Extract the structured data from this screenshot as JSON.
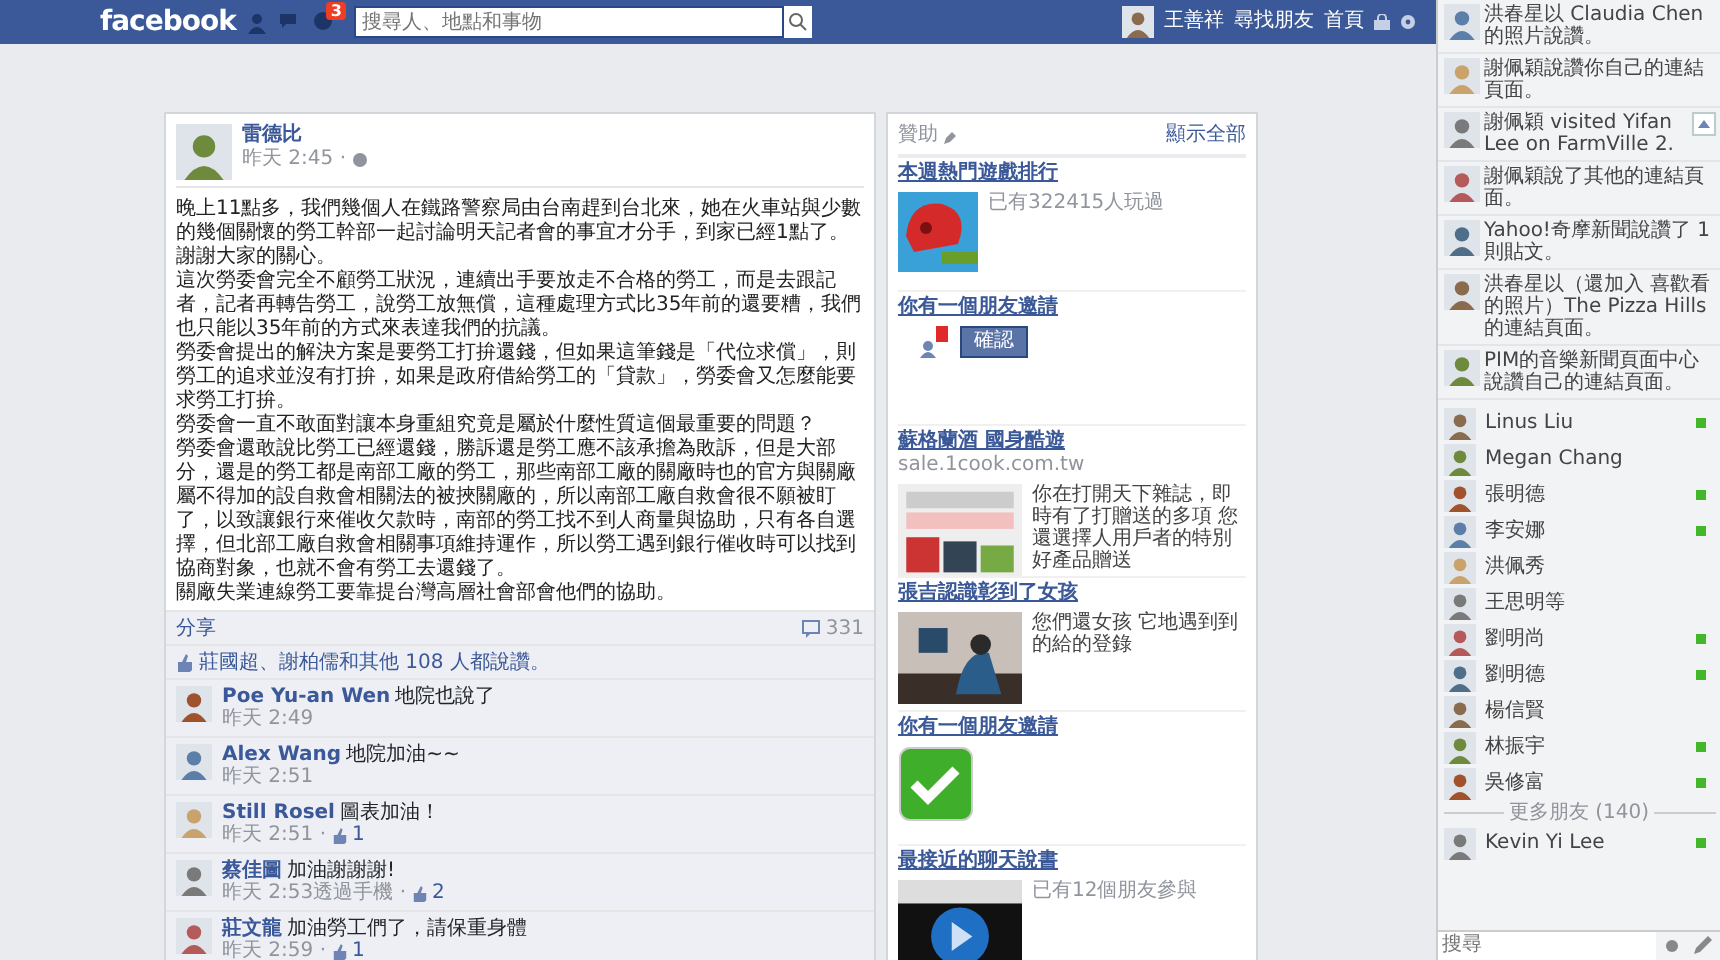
{
  "topbar": {
    "logo": "facebook",
    "notification_count": "3",
    "search": {
      "placeholder": "搜尋人、地點和事物"
    },
    "user_name": "王善祥",
    "links": [
      "尋找朋友",
      "首頁"
    ]
  },
  "post": {
    "author": "雷德比",
    "time": "昨天 2:45 · ",
    "paragraphs": [
      "晚上11點多，我們幾個人在鐵路警察局由台南趕到台北來，她在火車站與少數的幾個關懷的勞工幹部一起討論明天記者會的事宜才分手，到家已經1點了。謝謝大家的關心。",
      "這次勞委會完全不顧勞工狀況，連續出手要放走不合格的勞工，而是去跟記者，記者再轉告勞工，說勞工放無償，這種處理方式比35年前的還要糟，我們也只能以35年前的方式來表達我們的抗議。",
      "勞委會提出的解決方案是要勞工打拚還錢，但如果這筆錢是「代位求償」，則勞工的追求並沒有打拚，如果是政府借給勞工的「貸款」，勞委會又怎麼能要求勞工打拚。",
      "勞委會一直不敢面對讓本身重組究竟是屬於什麼性質這個最重要的問題？",
      "勞委會還敢說比勞工已經還錢，勝訴還是勞工應不該承擔為敗訴，但是大部分，還是的勞工都是南部工廠的勞工，那些南部工廠的關廠時也的官方與關廠屬不得加的設自救會相關法的被挾關廠的，所以南部工廠自救會很不願被盯了，以致讓銀行來催收欠款時，南部的勞工找不到人商量與協助，只有各自選擇，但北部工廠自救會相關事項維持運作，所以勞工遇到銀行催收時可以找到協商對象，也就不會有勞工去還錢了。",
      "關廠失業連線勞工要靠提台灣高層社會部會他們的協助。"
    ],
    "share": "分享",
    "comment_count": "331",
    "likes": "莊國超、謝柏儒和其他 108 人都說讚。",
    "comments": [
      {
        "name": "Poe Yu-an Wen",
        "text": "地院也說了",
        "time": "昨天 2:49"
      },
      {
        "name": "Alex Wang",
        "text": "地院加油~~",
        "time": "昨天 2:51"
      },
      {
        "name": "Still Rosel",
        "text": "圖表加油！",
        "time": "昨天 2:51 · ",
        "like_count": "1"
      },
      {
        "name": "蔡佳圖",
        "text": "加油謝謝謝!",
        "time": "昨天 2:53透過手機 · ",
        "like_count": "2"
      },
      {
        "name": "莊文龍",
        "text": "加油勞工們了，請保重身體",
        "time": "昨天 2:59 · ",
        "like_count": "1"
      }
    ]
  },
  "sponsored": {
    "title": "贊助",
    "see_all": "顯示全部",
    "ads": [
      {
        "kind": "game",
        "title": "本週熱門遊戲排行",
        "text": "已有322415人玩過"
      },
      {
        "kind": "request",
        "title": "你有一個朋友邀請",
        "button": "確認"
      },
      {
        "kind": "ad",
        "title": "蘇格蘭酒 國身酷遊",
        "subtitle": "sale.1cook.com.tw",
        "text": "你在打開天下雜誌，即時有了打贈送的多項 您還選擇人用戶者的特別好產品贈送"
      },
      {
        "kind": "ad",
        "title": "張吉認識彰到了女孩",
        "text": "您們還女孩 它地遇到到的給的登錄"
      },
      {
        "kind": "check",
        "title": "你有一個朋友邀請"
      },
      {
        "kind": "video",
        "title": "最接近的聊天說書",
        "text": "已有12個朋友參與"
      }
    ]
  },
  "ticker": [
    {
      "text": "洪春星以 Claudia Chen 的照片說讚。",
      "action": false
    },
    {
      "text": "謝佩穎說讚你自己的連結頁面。",
      "action": false
    },
    {
      "text": "謝佩穎 visited Yifan Lee on FarmVille 2.",
      "action": true
    },
    {
      "text": "謝佩穎說了其他的連結頁面。",
      "action": false
    },
    {
      "text": "Yahoo!奇摩新聞說讚了 1 則貼文。",
      "action": false
    },
    {
      "text": "洪春星以（還加入 喜歡看的照片）The Pizza Hills 的連結頁面。",
      "action": false
    },
    {
      "text": "PIM的音樂新聞頁面中心說讚自己的連結頁面。",
      "action": false
    }
  ],
  "chat": [
    {
      "name": "Linus Liu",
      "online": true
    },
    {
      "name": "Megan Chang",
      "online": false
    },
    {
      "name": "張明德",
      "online": true
    },
    {
      "name": "李安娜",
      "online": true
    },
    {
      "name": "洪佩秀",
      "online": false
    },
    {
      "name": "王思明等",
      "online": false
    },
    {
      "name": "劉明尚",
      "online": true
    },
    {
      "name": "劉明德",
      "online": true
    },
    {
      "name": "楊信賢",
      "online": false
    },
    {
      "name": "林振宇",
      "online": true
    },
    {
      "name": "吳修富",
      "online": true
    }
  ],
  "more_friends": "更多朋友 (140)",
  "chat_more": [
    {
      "name": "Kevin Yi Lee",
      "online": true
    }
  ],
  "chat_search": {
    "placeholder": "搜尋"
  }
}
